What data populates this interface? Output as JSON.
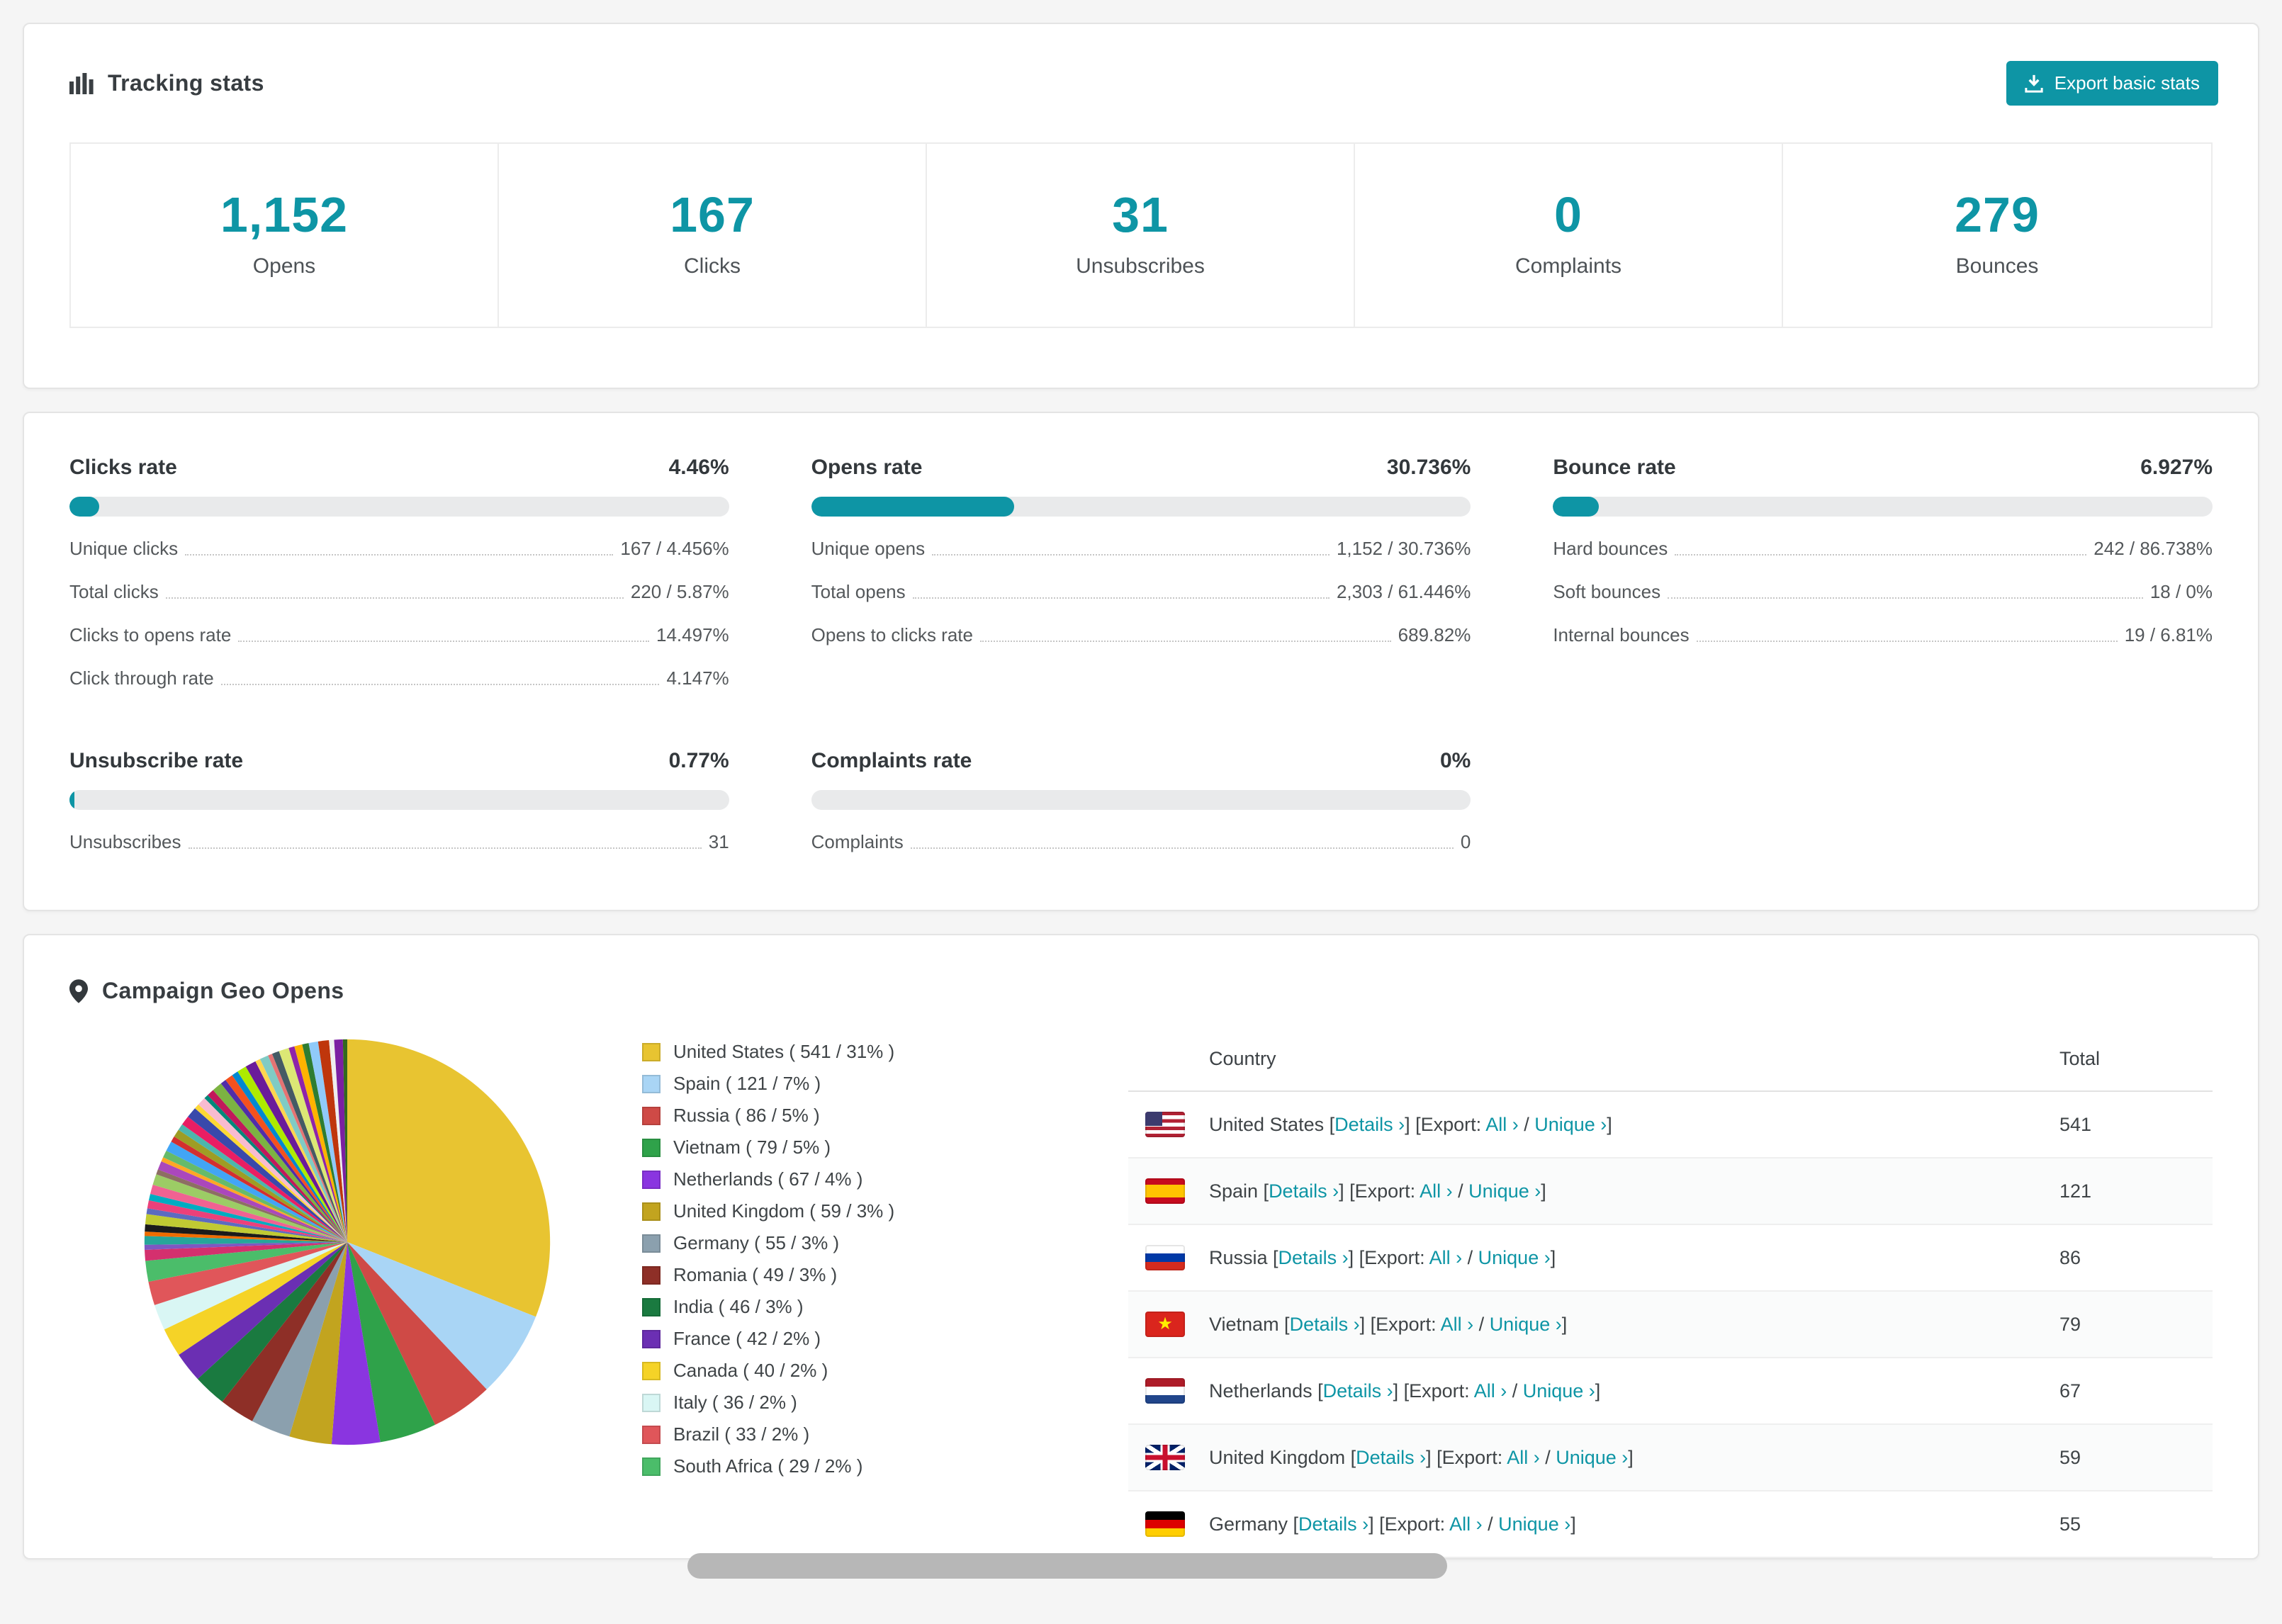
{
  "colors": {
    "accent": "#0e95a5",
    "bar_track": "#e9eaeb",
    "page_bg": "#f5f5f5"
  },
  "tracking": {
    "title": "Tracking stats",
    "export_button": "Export basic stats",
    "stats": [
      {
        "value": "1,152",
        "label": "Opens"
      },
      {
        "value": "167",
        "label": "Clicks"
      },
      {
        "value": "31",
        "label": "Unsubscribes"
      },
      {
        "value": "0",
        "label": "Complaints"
      },
      {
        "value": "279",
        "label": "Bounces"
      }
    ]
  },
  "rates": [
    {
      "title": "Clicks rate",
      "percent": "4.46%",
      "bar": 4.46,
      "rows": [
        {
          "label": "Unique clicks",
          "value": "167 / 4.456%"
        },
        {
          "label": "Total clicks",
          "value": "220 / 5.87%"
        },
        {
          "label": "Clicks to opens rate",
          "value": "14.497%"
        },
        {
          "label": "Click through rate",
          "value": "4.147%"
        }
      ]
    },
    {
      "title": "Opens rate",
      "percent": "30.736%",
      "bar": 30.736,
      "rows": [
        {
          "label": "Unique opens",
          "value": "1,152 / 30.736%"
        },
        {
          "label": "Total opens",
          "value": "2,303 / 61.446%"
        },
        {
          "label": "Opens to clicks rate",
          "value": "689.82%"
        }
      ]
    },
    {
      "title": "Bounce rate",
      "percent": "6.927%",
      "bar": 6.927,
      "rows": [
        {
          "label": "Hard bounces",
          "value": "242 / 86.738%"
        },
        {
          "label": "Soft bounces",
          "value": "18 / 0%"
        },
        {
          "label": "Internal bounces",
          "value": "19 / 6.81%"
        }
      ]
    },
    {
      "title": "Unsubscribe rate",
      "percent": "0.77%",
      "bar": 0.77,
      "rows": [
        {
          "label": "Unsubscribes",
          "value": "31"
        }
      ]
    },
    {
      "title": "Complaints rate",
      "percent": "0%",
      "bar": 0,
      "rows": [
        {
          "label": "Complaints",
          "value": "0"
        }
      ]
    }
  ],
  "geo": {
    "title": "Campaign Geo Opens",
    "link_labels": {
      "details": "Details",
      "export_prefix": "Export:",
      "all": "All",
      "unique": "Unique",
      "chevron": "›",
      "separator": "/"
    },
    "table": {
      "headers": {
        "country": "Country",
        "total": "Total"
      },
      "rows": [
        {
          "country": "United States",
          "flag": "us",
          "total": "541"
        },
        {
          "country": "Spain",
          "flag": "es",
          "total": "121"
        },
        {
          "country": "Russia",
          "flag": "ru",
          "total": "86"
        },
        {
          "country": "Vietnam",
          "flag": "vn",
          "total": "79"
        },
        {
          "country": "Netherlands",
          "flag": "nl",
          "total": "67"
        },
        {
          "country": "United Kingdom",
          "flag": "gb",
          "total": "59"
        },
        {
          "country": "Germany",
          "flag": "de",
          "total": "55"
        }
      ]
    }
  },
  "chart_data": {
    "type": "pie",
    "title": "Campaign Geo Opens",
    "legend_position": "right",
    "series": [
      {
        "name": "United States",
        "value": 541,
        "percent": 31,
        "color": "#e8c431"
      },
      {
        "name": "Spain",
        "value": 121,
        "percent": 7,
        "color": "#a9d5f5"
      },
      {
        "name": "Russia",
        "value": 86,
        "percent": 5,
        "color": "#cf4a46"
      },
      {
        "name": "Vietnam",
        "value": 79,
        "percent": 5,
        "color": "#2fa24a"
      },
      {
        "name": "Netherlands",
        "value": 67,
        "percent": 4,
        "color": "#8a35e0"
      },
      {
        "name": "United Kingdom",
        "value": 59,
        "percent": 3,
        "color": "#c2a41f"
      },
      {
        "name": "Germany",
        "value": 55,
        "percent": 3,
        "color": "#8ba0ae"
      },
      {
        "name": "Romania",
        "value": 49,
        "percent": 3,
        "color": "#8e2f27"
      },
      {
        "name": "India",
        "value": 46,
        "percent": 3,
        "color": "#1a7a40"
      },
      {
        "name": "France",
        "value": 42,
        "percent": 2,
        "color": "#6b2fb3"
      },
      {
        "name": "Canada",
        "value": 40,
        "percent": 2,
        "color": "#f5d327"
      },
      {
        "name": "Italy",
        "value": 36,
        "percent": 2,
        "color": "#d9f6f4"
      },
      {
        "name": "Brazil",
        "value": 33,
        "percent": 2,
        "color": "#e0565a"
      },
      {
        "name": "South Africa",
        "value": 29,
        "percent": 2,
        "color": "#4bbd6a"
      }
    ],
    "other_countries": {
      "value": 462,
      "slice_count": 44
    }
  }
}
